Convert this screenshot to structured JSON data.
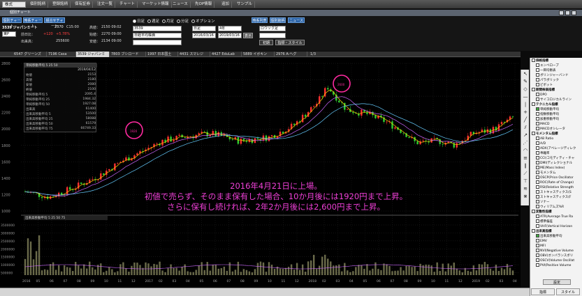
{
  "top_menu": [
    "株式",
    "個別銘柄",
    "登録銘柄",
    "保有証券",
    "注文一覧",
    "チャート",
    "マーケット情報",
    "ニュース",
    "先OP情報",
    "追加",
    "サンプル"
  ],
  "window_title": "個別チャート",
  "toolbar": {
    "chart_buttons": [
      "個別チャート",
      "時系チャート",
      "組合せチャート"
    ],
    "right_buttons": [
      "時系列表",
      "個別銘柄",
      "ニュース"
    ],
    "code_name": "3539 ジャパンミート",
    "price_label": "2370",
    "price_time": "C15:00",
    "high_label": "高値：",
    "high_val": "2150 09:02",
    "prev_label": "前日比：",
    "change": "+120",
    "change_pct": "+5.78%",
    "open_label": "始値：",
    "open_val": "2270 09:00",
    "vol_label": "出来高：",
    "vol_val": "255600",
    "low_label": "安値：",
    "low_val": "2134 09:00",
    "market": "東P",
    "radios": [
      "日足",
      "週足",
      "月足",
      "分足",
      "オプション"
    ],
    "code_field": "3539",
    "period_field": "日足",
    "count_field": "4年",
    "chart_style": "ロウソク足",
    "env_field": "日経平均株価",
    "date_from": "2016/03/16",
    "date_to": "2019/03/16",
    "display_button": "表示",
    "reset_button": "初期",
    "indicator_button": "指標・スタイル"
  },
  "symbol_tabs": [
    "6547 グリーンズ",
    "7196 Casa",
    "3539 ジャパンミ",
    "7803 ブシロード",
    "1997 日本国土",
    "4431 スマレジ",
    "4427 EduLab",
    "5889 イボキン",
    "2976 A-ヘグ"
  ],
  "tab_pager": "1/3",
  "legend_main": {
    "title": "単純移動平均",
    "params": "5 25 50",
    "date": "2019/04/12",
    "rows": [
      {
        "k": "始値",
        "v": "2153"
      },
      {
        "k": "高値",
        "v": "2180"
      },
      {
        "k": "安値",
        "v": "2080"
      },
      {
        "k": "終値",
        "v": "2100"
      },
      {
        "k": "単純移動平均 5",
        "v": "2095.4"
      },
      {
        "k": "単純移動平均 25",
        "v": "1984.32"
      },
      {
        "k": "単純移動平均 50",
        "v": "1927.08"
      },
      {
        "k": "出来高",
        "v": "61400"
      },
      {
        "k": "出来高移動平均 5",
        "v": "53500"
      },
      {
        "k": "出来高移動平均 25",
        "v": "58088"
      },
      {
        "k": "出来高移動平均 50",
        "v": "61579"
      },
      {
        "k": "出来高移動平均 75",
        "v": "66749.33"
      }
    ]
  },
  "legend_volume": {
    "title": "出来高移動平均",
    "params": "5 25 50 75"
  },
  "y_axis_price": [
    "2800",
    "2600",
    "2400",
    "2200",
    "2000",
    "1800",
    "1600",
    "1400",
    "1200",
    "1000"
  ],
  "y_axis_volume": [
    "3500000",
    "3000000",
    "2500000",
    "2000000",
    "1500000",
    "1000000",
    "500000"
  ],
  "x_axis": [
    "2016",
    "05",
    "06",
    "07",
    "08",
    "09",
    "10",
    "11",
    "12",
    "2017",
    "02",
    "03",
    "04",
    "05",
    "06",
    "07",
    "08",
    "09",
    "10",
    "11",
    "12",
    "2018",
    "02",
    "03",
    "04",
    "05",
    "06",
    "07",
    "08",
    "09",
    "10",
    "11",
    "12",
    "2019",
    "02",
    "03",
    "04"
  ],
  "annotation": [
    "2016年4月21日に上場。",
    "初値で売らず、そのまま保有した場合、10か月後には1920円まで上昇。",
    "さらに保有し続ければ、2年2か月後には2,600円まで上昇。"
  ],
  "highlight_labels": [
    "1920",
    "2600"
  ],
  "right_panel": {
    "items": [
      {
        "t": "cat",
        "l": "価格指標"
      },
      {
        "t": "i",
        "l": "エンベロープ"
      },
      {
        "t": "i",
        "l": "一目均衡表"
      },
      {
        "t": "i",
        "l": "ボリンジャーバンド"
      },
      {
        "t": "i",
        "l": "パラボリック"
      },
      {
        "t": "i",
        "l": "ピボット"
      },
      {
        "t": "cat",
        "l": "期間株価指標"
      },
      {
        "t": "i",
        "l": "DPO"
      },
      {
        "t": "i",
        "l": "サイコロジカルライン"
      },
      {
        "t": "cat",
        "l": "テクニカル指標"
      },
      {
        "t": "i",
        "l": "単純移動平均",
        "c": true
      },
      {
        "t": "i",
        "l": "指数移動平均"
      },
      {
        "t": "i",
        "l": "加重移動平均"
      },
      {
        "t": "i",
        "l": "MACD"
      },
      {
        "t": "i",
        "l": "MACDオシレータ"
      },
      {
        "t": "cat",
        "l": "モメンタム指標"
      },
      {
        "t": "i",
        "l": "AB Ratio"
      },
      {
        "t": "i",
        "l": "A/D"
      },
      {
        "t": "i",
        "l": "ADX(アベレージディレク"
      },
      {
        "t": "i",
        "l": "乖離率"
      },
      {
        "t": "i",
        "l": "CCI(コモディティ・チャ"
      },
      {
        "t": "i",
        "l": "DMI(ディレクショナル"
      },
      {
        "t": "i",
        "l": "ME(Mass Index)"
      },
      {
        "t": "i",
        "l": "モメンタム"
      },
      {
        "t": "i",
        "l": "OSCP(Price Oscillator"
      },
      {
        "t": "i",
        "l": "ROC(Rate of Change)"
      },
      {
        "t": "i",
        "l": "RSI(Relative Strength"
      },
      {
        "t": "i",
        "l": "ストキャスティクス(S"
      },
      {
        "t": "i",
        "l": "ストキャスティクス(F"
      },
      {
        "t": "i",
        "l": "ソナー"
      },
      {
        "t": "i",
        "l": "ウィリアムズ%R"
      },
      {
        "t": "cat",
        "l": "変動性指標"
      },
      {
        "t": "i",
        "l": "ATR(Average True Ra"
      },
      {
        "t": "i",
        "l": "標準偏差"
      },
      {
        "t": "i",
        "l": "VHF(Vertical Horizon"
      },
      {
        "t": "cat",
        "l": "出来高指標"
      },
      {
        "t": "i",
        "l": "出来高移動平均",
        "c": true
      },
      {
        "t": "i",
        "l": "EMV"
      },
      {
        "t": "i",
        "l": "MFI"
      },
      {
        "t": "i",
        "l": "NVI(Negative Volume"
      },
      {
        "t": "i",
        "l": "OBV(オンバランスボリ"
      },
      {
        "t": "i",
        "l": "OSCV(Volume Oscillat"
      },
      {
        "t": "i",
        "l": "PVI(Positive Volume"
      }
    ],
    "settings_button": "設定",
    "tab_indicator": "指標",
    "tab_style": "スタイル"
  },
  "colors": {
    "up": "#ff3030",
    "down": "#30d030",
    "ma5": "#ffcc00",
    "ma25": "#cc66ff",
    "ma50": "#66ccff",
    "annot": "#ee3fd6",
    "highlight": "#ff2aa0"
  }
}
